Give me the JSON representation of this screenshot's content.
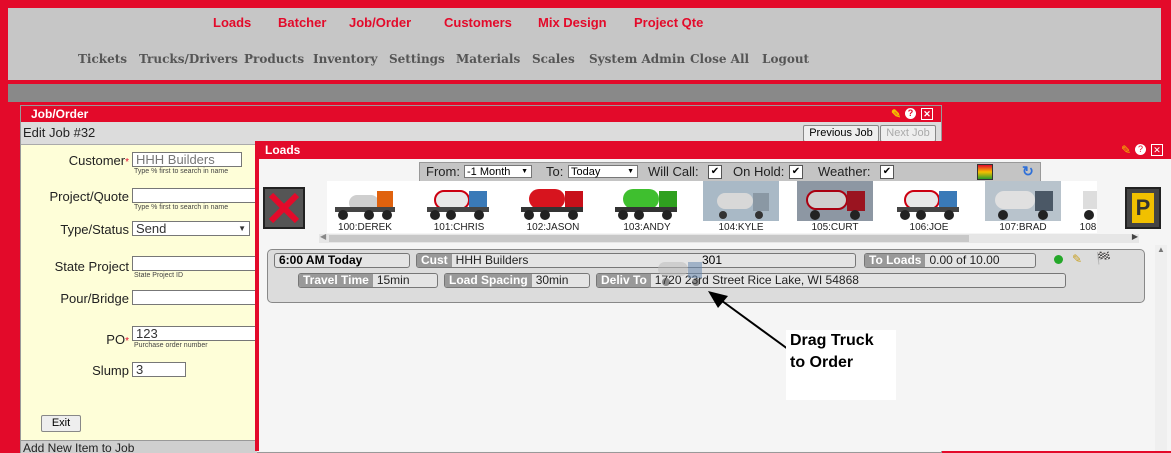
{
  "colors": {
    "brand_red": "#e30a2a",
    "menu_gray": "#c6c6c6"
  },
  "menu_primary": [
    "Loads",
    "Batcher",
    "Job/Order",
    "Customers",
    "Mix Design",
    "Project Qte"
  ],
  "menu_secondary": [
    "Tickets",
    "Trucks/Drivers",
    "Products",
    "Inventory",
    "Settings",
    "Materials",
    "Scales",
    "System Admin",
    "Close All",
    "Logout"
  ],
  "job_panel": {
    "title": "Job/Order",
    "subtitle": "Edit Job #32",
    "prev_button": "Previous Job",
    "next_button": "Next Job",
    "icons": [
      "pin-icon",
      "help-icon",
      "close-icon"
    ]
  },
  "form": {
    "customer": {
      "label": "Customer",
      "value": "HHH Builders",
      "hint": "Type % first to search in name"
    },
    "project": {
      "label": "Project/Quote",
      "value": "",
      "hint": "Type % first to search in name"
    },
    "type_status": {
      "label": "Type/Status",
      "value": "Send"
    },
    "state_project": {
      "label": "State Project",
      "value": "",
      "hint": "State Project ID"
    },
    "pour_bridge": {
      "label": "Pour/Bridge",
      "value": ""
    },
    "po": {
      "label": "PO",
      "value": "123",
      "hint": "Purchase order number"
    },
    "slump": {
      "label": "Slump",
      "value": "3"
    },
    "exit_button": "Exit",
    "add_item": "Add New Item to Job"
  },
  "loads": {
    "title": "Loads",
    "filters": {
      "from_label": "From:",
      "from_value": "-1 Month",
      "to_label": "To:",
      "to_value": "Today",
      "will_call": "Will Call:",
      "on_hold": "On Hold:",
      "weather": "Weather:",
      "check": "✔"
    },
    "trucks": [
      "100:DEREK",
      "101:CHRIS",
      "102:JASON",
      "103:ANDY",
      "104:KYLE",
      "105:CURT",
      "106:JOE",
      "107:BRAD",
      "108"
    ],
    "order": {
      "time": "6:00 AM Today",
      "cust_label": "Cust",
      "cust_value": "HHH Builders",
      "mix_value": "301",
      "to_loads_label": "To Loads",
      "to_loads_value": "0.00 of 10.00",
      "travel_label": "Travel Time",
      "travel_value": "15min",
      "spacing_label": "Load Spacing",
      "spacing_value": "30min",
      "deliv_label": "Deliv To",
      "deliv_value": "1720 23rd Street Rice Lake, WI 54868"
    }
  },
  "annotation": {
    "line1": "Drag Truck",
    "line2": "to Order"
  }
}
